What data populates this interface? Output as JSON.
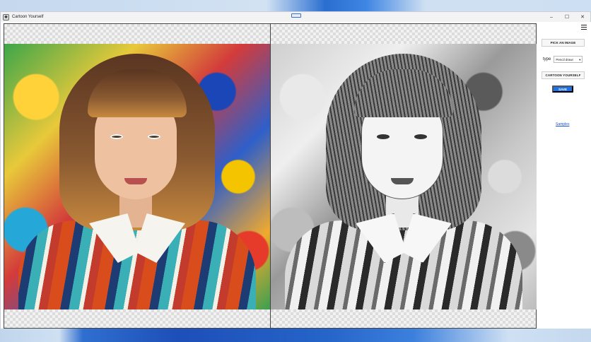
{
  "window": {
    "title": "Cartoon Yourself",
    "controls": {
      "minimize": "–",
      "maximize": "☐",
      "close": "✕"
    }
  },
  "panel": {
    "pick_label": "PICK AN IMAGE",
    "type_label": "type",
    "type_value": "Pencil drawi",
    "type_caret": "▾",
    "cartoon_label": "CARTOON YOURSELF",
    "save_label": "SAVE",
    "samples_label": "Samples"
  },
  "colors": {
    "accent": "#1a73e8",
    "link": "#1a4fd6"
  },
  "images": {
    "left": "original-photo",
    "right": "pencil-drawing-result"
  }
}
